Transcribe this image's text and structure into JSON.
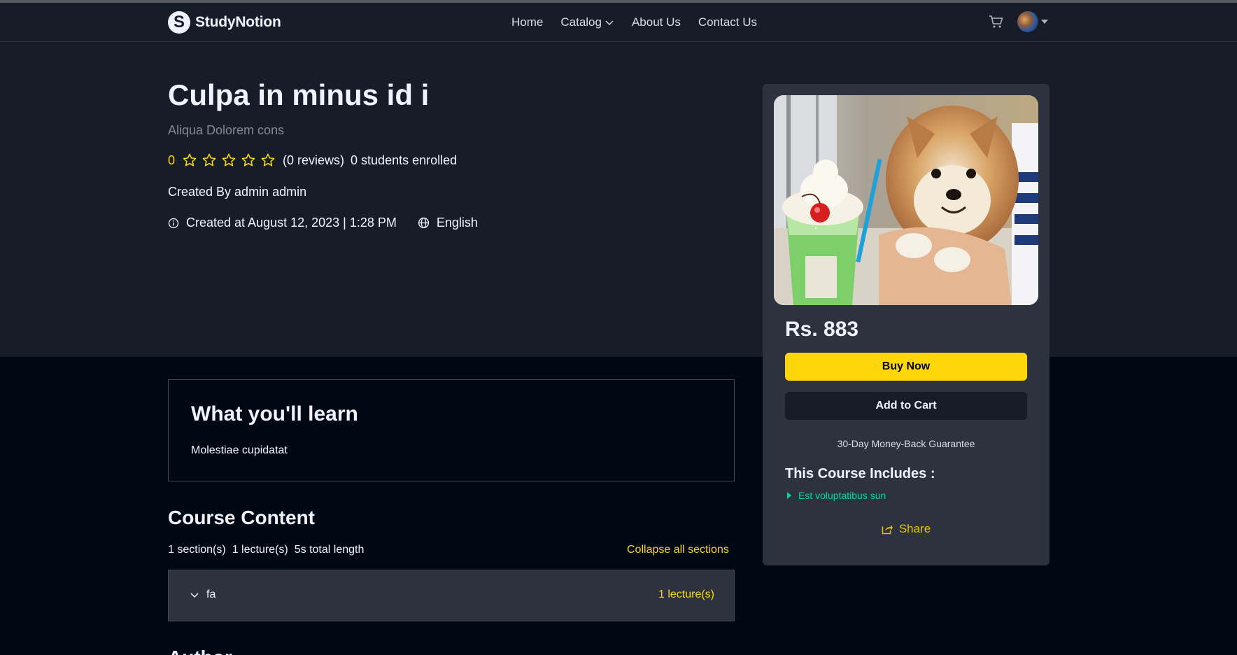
{
  "nav": {
    "logo_mark": "S",
    "logo_text": "StudyNotion",
    "links": [
      "Home",
      "Catalog",
      "About Us",
      "Contact Us"
    ]
  },
  "course": {
    "title": "Culpa in minus id i",
    "subtitle": "Aliqua Dolorem cons",
    "rating": "0",
    "rating_stars_filled": 0,
    "rating_stars_total": 5,
    "reviews": "(0 reviews)",
    "enrolled": "0 students enrolled",
    "created_by": "Created By admin admin",
    "created_at": "Created at August 12, 2023 | 1:28 PM",
    "language": "English"
  },
  "card": {
    "price": "Rs. 883",
    "buy_label": "Buy Now",
    "cart_label": "Add to Cart",
    "guarantee": "30-Day Money-Back Guarantee",
    "includes_title": "This Course Includes :",
    "includes_items": [
      "Est voluptatibus sun"
    ],
    "share_label": "Share"
  },
  "learn": {
    "title": "What you'll learn",
    "text": "Molestiae cupidatat"
  },
  "content": {
    "title": "Course Content",
    "sections": "1 section(s)",
    "lectures": "1 lecture(s)",
    "length": "5s total length",
    "collapse_label": "Collapse all sections",
    "section_items": [
      {
        "name": "fa",
        "count": "1 lecture(s)"
      }
    ]
  },
  "author": {
    "title": "Author"
  },
  "colors": {
    "accent_yellow": "#FFD60A",
    "accent_green": "#06D6A0",
    "bg_dark": "#000814",
    "bg_panel": "#161D29",
    "card_bg": "#2C333F"
  }
}
